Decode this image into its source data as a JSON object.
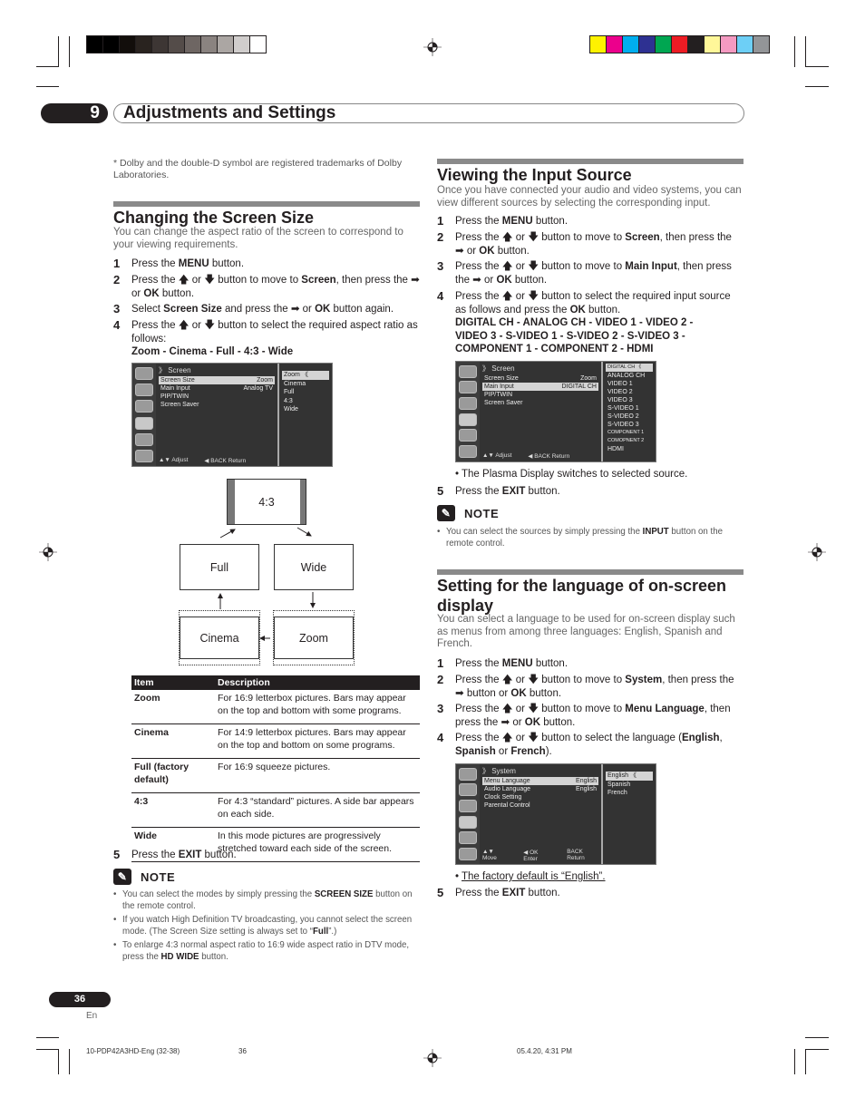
{
  "print_marks": {
    "grayscale_bar": [
      "#000000",
      "#000000",
      "#120e0b",
      "#29231f",
      "#3d3634",
      "#544c49",
      "#6e6663",
      "#8a8380",
      "#aba6a3",
      "#d0cdcc",
      "#ffffff"
    ],
    "color_bar": [
      "#fff200",
      "#ec008c",
      "#00aeef",
      "#2e3192",
      "#00a651",
      "#ed1c24",
      "#231f20",
      "#fff799",
      "#f49ac1",
      "#6dcff6",
      "#939598"
    ]
  },
  "header": {
    "chapter_number": "9",
    "chapter_title": "Adjustments and Settings"
  },
  "footnote": "* Dolby and the double-D symbol are registered trademarks of Dolby Laboratories.",
  "screen_size": {
    "title": "Changing the Screen Size",
    "intro": "You can change the aspect ratio of the screen to correspond to your viewing requirements.",
    "steps": [
      {
        "num": "1",
        "html": "Press the <b>MENU</b> button."
      },
      {
        "num": "2",
        "html": "Press the &#129093; or &#129095; button to move to <b>Screen</b>, then press the &#10145; or <b>OK</b> button."
      },
      {
        "num": "3",
        "html": "Select <b>Screen Size</b> and press the &#10145; or <b>OK</b> button again."
      },
      {
        "num": "4",
        "html": "Press the &#129093; or &#129095; button to select the required aspect ratio as follows:"
      }
    ],
    "sequence": "Zoom - Cinema - Full - 4:3 - Wide",
    "osd": {
      "title": "》 Screen",
      "rows": [
        {
          "label": "Screen Size",
          "value": "Zoom",
          "highlighted": true
        },
        {
          "label": "Main Input",
          "value": "Analog TV",
          "highlighted": false
        },
        {
          "label": "PIP/TWIN",
          "value": "",
          "highlighted": false
        },
        {
          "label": "Screen Saver",
          "value": "",
          "highlighted": false
        }
      ],
      "footer": [
        "▲▼ Adjust",
        "◀ BACK Return"
      ],
      "options": [
        "Zoom 《",
        "Cinema",
        "Full",
        "4:3",
        "Wide"
      ]
    },
    "diagram": {
      "top": "4:3",
      "left_top": "Full",
      "right_top": "Wide",
      "left_bottom": "Cinema",
      "right_bottom": "Zoom"
    },
    "table": {
      "headers": [
        "Item",
        "Description"
      ],
      "rows": [
        [
          "Zoom",
          "For 16:9 letterbox pictures. Bars may appear on the top and bottom with some programs."
        ],
        [
          "Cinema",
          "For 14:9 letterbox pictures. Bars may appear on the top and bottom on some programs."
        ],
        [
          "Full (factory default)",
          "For 16:9 squeeze pictures."
        ],
        [
          "4:3",
          "For 4:3 “standard” pictures. A side bar appears on each side."
        ],
        [
          "Wide",
          "In this mode pictures are progressively stretched toward each side of the screen."
        ]
      ]
    },
    "step5": {
      "num": "5",
      "html": "Press the <b>EXIT</b> button."
    },
    "note_title": "NOTE",
    "notes": [
      "You can select the modes by simply pressing the <b>SCREEN SIZE</b> button on the remote control.",
      "If you watch High Definition TV broadcasting, you cannot select the screen mode. (The Screen Size setting is always set to “<b>Full</b>”.)",
      "To enlarge 4:3 normal aspect ratio to 16:9 wide aspect ratio in DTV mode, press the <b>HD WIDE</b> button."
    ]
  },
  "input_source": {
    "title": "Viewing the Input Source",
    "intro": "Once you have connected your audio and video systems, you can view different sources by selecting the corresponding input.",
    "steps": [
      {
        "num": "1",
        "html": "Press the <b>MENU</b> button."
      },
      {
        "num": "2",
        "html": "Press the &#129093; or &#129095; button to move to <b>Screen</b>, then press the &#10145; or <b>OK</b> button."
      },
      {
        "num": "3",
        "html": "Press the &#129093; or &#129095; button to move to <b>Main Input</b>, then press the &#10145; or <b>OK</b> button."
      },
      {
        "num": "4",
        "html": "Press the &#129093; or &#129095; button to select the required input source as follows and press the <b>OK</b> button."
      }
    ],
    "sequence": "DIGITAL CH - ANALOG CH - VIDEO 1 - VIDEO 2 - VIDEO 3 - S-VIDEO 1 - S-VIDEO 2 - S-VIDEO 3 - COMPONENT 1 - COMPONENT 2 - HDMI",
    "osd": {
      "title": "》 Screen",
      "rows": [
        {
          "label": "Screen Size",
          "value": "Zoom",
          "highlighted": false
        },
        {
          "label": "Main Input",
          "value": "DIGITAL CH",
          "highlighted": true
        },
        {
          "label": "PIP/TWIN",
          "value": "",
          "highlighted": false
        },
        {
          "label": "Screen Saver",
          "value": "",
          "highlighted": false
        }
      ],
      "footer": [
        "▲▼ Adjust",
        "◀ BACK Return"
      ],
      "options": [
        "DIGITAL CH 《",
        "ANALOG CH",
        "VIDEO 1",
        "VIDEO 2",
        "VIDEO 3",
        "S-VIDEO 1",
        "S-VIDEO 2",
        "S-VIDEO 3",
        "COMPONENT 1",
        "COMOPNENT 2",
        "HDMI"
      ]
    },
    "bullet": "The Plasma Display switches to selected source.",
    "step5": {
      "num": "5",
      "html": "Press the <b>EXIT</b> button."
    },
    "note_title": "NOTE",
    "notes": [
      "You can select the sources by simply pressing the <b>INPUT</b> button on the remote control."
    ]
  },
  "language": {
    "title": "Setting for the language of on-screen display",
    "intro": "You can select a language to be used for on-screen display such as menus from among three languages: English, Spanish and French.",
    "steps": [
      {
        "num": "1",
        "html": "Press the <b>MENU</b> button."
      },
      {
        "num": "2",
        "html": "Press the &#129093; or &#129095; button to move to <b>System</b>, then press the &#10145; button or <b>OK</b> button."
      },
      {
        "num": "3",
        "html": "Press the &#129093; or &#129095; button to move to <b>Menu Language</b>, then press the &#10145; or <b>OK</b> button."
      },
      {
        "num": "4",
        "html": "Press the &#129093; or &#129095; button to select the language (<b>English</b>, <b>Spanish</b> or <b>French</b>)."
      }
    ],
    "osd": {
      "title": "》 System",
      "rows": [
        {
          "label": "Menu Language",
          "value": "English",
          "highlighted": true
        },
        {
          "label": "Audio Language",
          "value": "English",
          "highlighted": false
        },
        {
          "label": "Clock Setting",
          "value": "",
          "highlighted": false
        },
        {
          "label": "Parental Control",
          "value": "",
          "highlighted": false
        }
      ],
      "footer": [
        "▲▼ Move",
        "◀ OK Enter",
        "BACK Return"
      ],
      "options": [
        "English 《",
        "Spanish",
        "French"
      ]
    },
    "bullet": "The factory default is “English”.",
    "step5": {
      "num": "5",
      "html": "Press the <b>EXIT</b> button."
    }
  },
  "footer": {
    "page_number": "36",
    "lang": "En",
    "file": "10-PDP42A3HD-Eng (32-38)",
    "page": "36",
    "timestamp": "05.4.20, 4:31 PM"
  }
}
